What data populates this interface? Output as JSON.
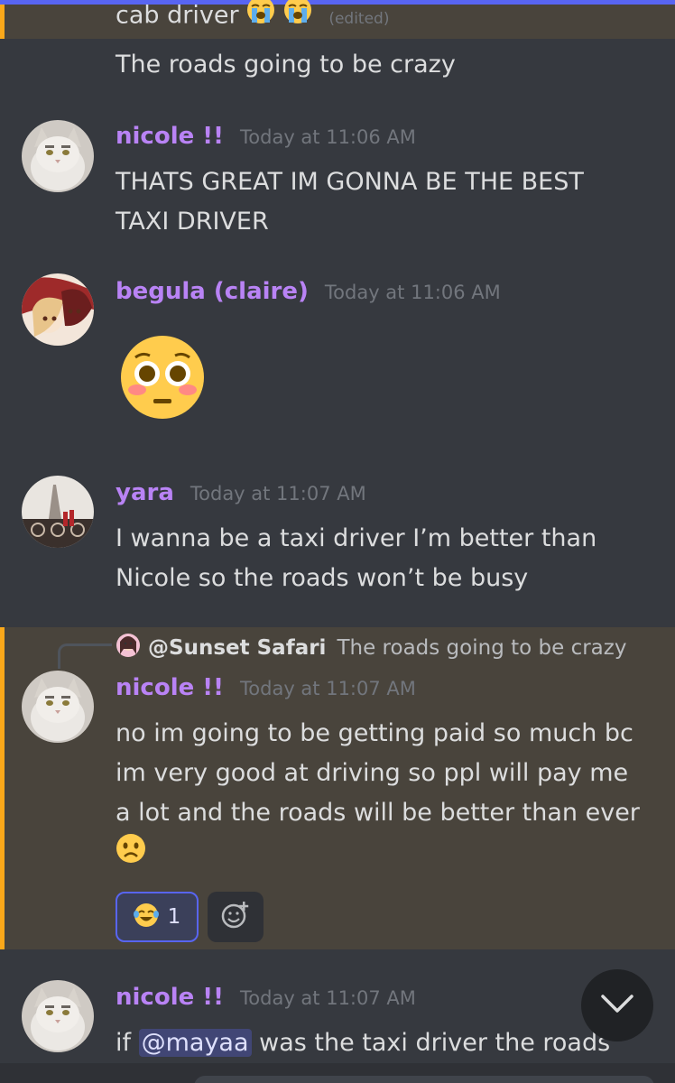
{
  "continued": {
    "line1": "cab driver",
    "edited_label": "(edited)",
    "line2": "The roads going to be crazy"
  },
  "messages": [
    {
      "username": "nicole !!",
      "timestamp": "Today at 11:06 AM",
      "lines": [
        "THATS GREAT IM GONNA BE THE BEST",
        "TAXI DRIVER"
      ]
    },
    {
      "username": "begula (claire)",
      "timestamp": "Today at 11:06 AM",
      "emoji": "flushed-face"
    },
    {
      "username": "yara",
      "timestamp": "Today at 11:07 AM",
      "lines": [
        "I wanna be a taxi driver I’m better than",
        "Nicole so the roads won’t be busy"
      ]
    },
    {
      "username": "nicole !!",
      "timestamp": "Today at 11:07 AM",
      "reply": {
        "author": "@Sunset Safari",
        "text": "The roads going to be crazy"
      },
      "lines": [
        "no im going to be getting paid so much bc",
        "im very good at driving so ppl will pay me",
        "a lot and the roads will be better than ever"
      ],
      "trailing_emoji": "frowning-face",
      "reactions": [
        {
          "emoji": "joy-face",
          "count": "1"
        }
      ]
    },
    {
      "username": "nicole !!",
      "timestamp": "Today at 11:07 AM",
      "text_before": "if",
      "mention": "@mayaa",
      "text_after": "was the taxi driver the roads"
    }
  ],
  "colors": {
    "background": "#36393f",
    "username": "#b983f5",
    "timestamp": "#72767d",
    "highlight": "#49443c",
    "highlight_bar": "#faa81a",
    "accent": "#5865f2"
  }
}
